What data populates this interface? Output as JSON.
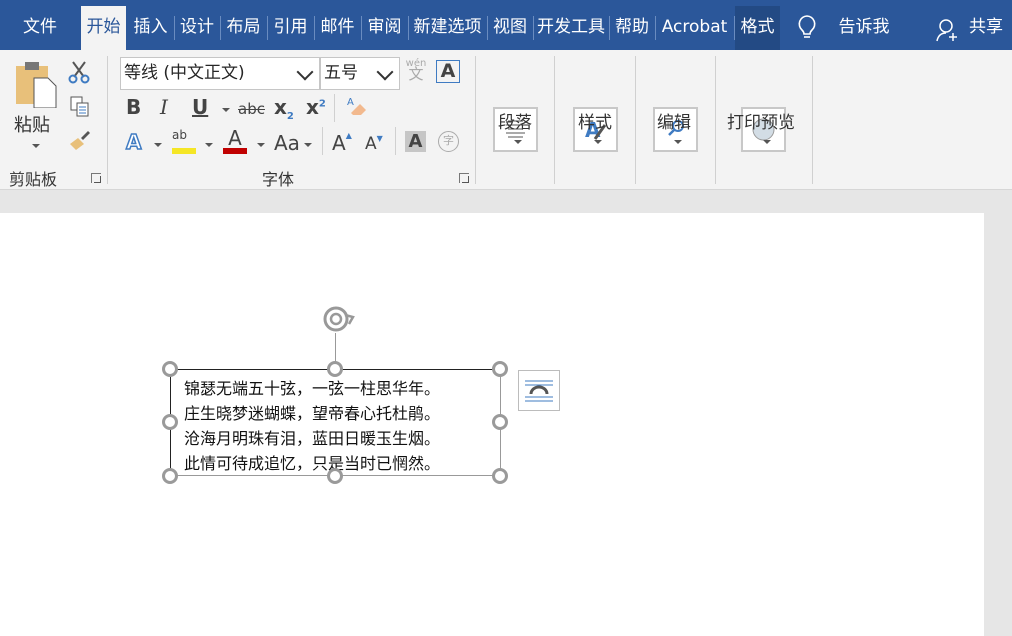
{
  "tabs": {
    "file": "文件",
    "items": [
      "开始",
      "插入",
      "设计",
      "布局",
      "引用",
      "邮件",
      "审阅",
      "新建选项",
      "视图",
      "开发工具",
      "帮助",
      "Acrobat",
      "格式"
    ],
    "tell_me": "告诉我",
    "share": "共享"
  },
  "clipboard": {
    "paste": "粘贴",
    "group_label": "剪贴板"
  },
  "font": {
    "font_name": "等线 (中文正文)",
    "font_size": "五号",
    "phonetic_top": "wén",
    "phonetic_bottom": "文",
    "group_label": "字体",
    "bold": "B",
    "italic": "I",
    "underline": "U",
    "strike": "abc",
    "subscript": "x",
    "subscript_mark": "2",
    "superscript": "x",
    "superscript_mark": "2",
    "change_case": "Aa",
    "enclose": "字",
    "highlight_text": "ab",
    "highlight_color": "#f5e625",
    "font_color": "#c00000"
  },
  "groups": {
    "paragraph": "段落",
    "styles": "样式",
    "editing": "编辑",
    "print_preview": "打印预览"
  },
  "document": {
    "textbox_lines": [
      "锦瑟无端五十弦，一弦一柱思华年。",
      "庄生晓梦迷蝴蝶，望帝春心托杜鹃。",
      "沧海月明珠有泪，蓝田日暖玉生烟。",
      "此情可待成追忆，只是当时已惘然。"
    ]
  },
  "colors": {
    "tabbar": "#2b579a",
    "ribbon": "#f3f3f3"
  }
}
